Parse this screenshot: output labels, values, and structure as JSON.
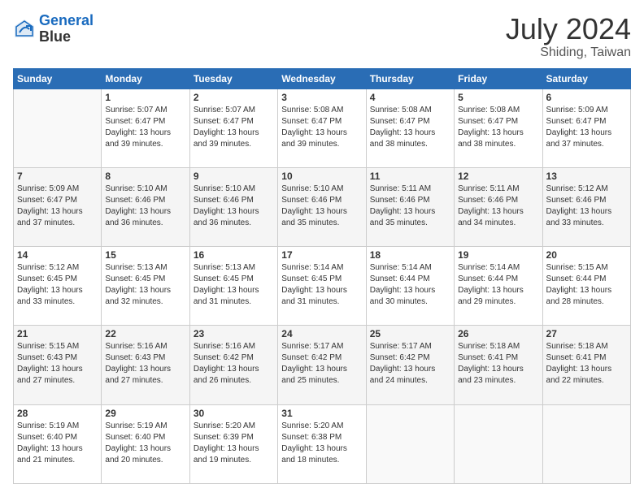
{
  "header": {
    "logo_line1": "General",
    "logo_line2": "Blue",
    "title": "July 2024",
    "subtitle": "Shiding, Taiwan"
  },
  "days_of_week": [
    "Sunday",
    "Monday",
    "Tuesday",
    "Wednesday",
    "Thursday",
    "Friday",
    "Saturday"
  ],
  "weeks": [
    [
      {
        "day": "",
        "info": ""
      },
      {
        "day": "1",
        "info": "Sunrise: 5:07 AM\nSunset: 6:47 PM\nDaylight: 13 hours\nand 39 minutes."
      },
      {
        "day": "2",
        "info": "Sunrise: 5:07 AM\nSunset: 6:47 PM\nDaylight: 13 hours\nand 39 minutes."
      },
      {
        "day": "3",
        "info": "Sunrise: 5:08 AM\nSunset: 6:47 PM\nDaylight: 13 hours\nand 39 minutes."
      },
      {
        "day": "4",
        "info": "Sunrise: 5:08 AM\nSunset: 6:47 PM\nDaylight: 13 hours\nand 38 minutes."
      },
      {
        "day": "5",
        "info": "Sunrise: 5:08 AM\nSunset: 6:47 PM\nDaylight: 13 hours\nand 38 minutes."
      },
      {
        "day": "6",
        "info": "Sunrise: 5:09 AM\nSunset: 6:47 PM\nDaylight: 13 hours\nand 37 minutes."
      }
    ],
    [
      {
        "day": "7",
        "info": "Sunrise: 5:09 AM\nSunset: 6:47 PM\nDaylight: 13 hours\nand 37 minutes."
      },
      {
        "day": "8",
        "info": "Sunrise: 5:10 AM\nSunset: 6:46 PM\nDaylight: 13 hours\nand 36 minutes."
      },
      {
        "day": "9",
        "info": "Sunrise: 5:10 AM\nSunset: 6:46 PM\nDaylight: 13 hours\nand 36 minutes."
      },
      {
        "day": "10",
        "info": "Sunrise: 5:10 AM\nSunset: 6:46 PM\nDaylight: 13 hours\nand 35 minutes."
      },
      {
        "day": "11",
        "info": "Sunrise: 5:11 AM\nSunset: 6:46 PM\nDaylight: 13 hours\nand 35 minutes."
      },
      {
        "day": "12",
        "info": "Sunrise: 5:11 AM\nSunset: 6:46 PM\nDaylight: 13 hours\nand 34 minutes."
      },
      {
        "day": "13",
        "info": "Sunrise: 5:12 AM\nSunset: 6:46 PM\nDaylight: 13 hours\nand 33 minutes."
      }
    ],
    [
      {
        "day": "14",
        "info": "Sunrise: 5:12 AM\nSunset: 6:45 PM\nDaylight: 13 hours\nand 33 minutes."
      },
      {
        "day": "15",
        "info": "Sunrise: 5:13 AM\nSunset: 6:45 PM\nDaylight: 13 hours\nand 32 minutes."
      },
      {
        "day": "16",
        "info": "Sunrise: 5:13 AM\nSunset: 6:45 PM\nDaylight: 13 hours\nand 31 minutes."
      },
      {
        "day": "17",
        "info": "Sunrise: 5:14 AM\nSunset: 6:45 PM\nDaylight: 13 hours\nand 31 minutes."
      },
      {
        "day": "18",
        "info": "Sunrise: 5:14 AM\nSunset: 6:44 PM\nDaylight: 13 hours\nand 30 minutes."
      },
      {
        "day": "19",
        "info": "Sunrise: 5:14 AM\nSunset: 6:44 PM\nDaylight: 13 hours\nand 29 minutes."
      },
      {
        "day": "20",
        "info": "Sunrise: 5:15 AM\nSunset: 6:44 PM\nDaylight: 13 hours\nand 28 minutes."
      }
    ],
    [
      {
        "day": "21",
        "info": "Sunrise: 5:15 AM\nSunset: 6:43 PM\nDaylight: 13 hours\nand 27 minutes."
      },
      {
        "day": "22",
        "info": "Sunrise: 5:16 AM\nSunset: 6:43 PM\nDaylight: 13 hours\nand 27 minutes."
      },
      {
        "day": "23",
        "info": "Sunrise: 5:16 AM\nSunset: 6:42 PM\nDaylight: 13 hours\nand 26 minutes."
      },
      {
        "day": "24",
        "info": "Sunrise: 5:17 AM\nSunset: 6:42 PM\nDaylight: 13 hours\nand 25 minutes."
      },
      {
        "day": "25",
        "info": "Sunrise: 5:17 AM\nSunset: 6:42 PM\nDaylight: 13 hours\nand 24 minutes."
      },
      {
        "day": "26",
        "info": "Sunrise: 5:18 AM\nSunset: 6:41 PM\nDaylight: 13 hours\nand 23 minutes."
      },
      {
        "day": "27",
        "info": "Sunrise: 5:18 AM\nSunset: 6:41 PM\nDaylight: 13 hours\nand 22 minutes."
      }
    ],
    [
      {
        "day": "28",
        "info": "Sunrise: 5:19 AM\nSunset: 6:40 PM\nDaylight: 13 hours\nand 21 minutes."
      },
      {
        "day": "29",
        "info": "Sunrise: 5:19 AM\nSunset: 6:40 PM\nDaylight: 13 hours\nand 20 minutes."
      },
      {
        "day": "30",
        "info": "Sunrise: 5:20 AM\nSunset: 6:39 PM\nDaylight: 13 hours\nand 19 minutes."
      },
      {
        "day": "31",
        "info": "Sunrise: 5:20 AM\nSunset: 6:38 PM\nDaylight: 13 hours\nand 18 minutes."
      },
      {
        "day": "",
        "info": ""
      },
      {
        "day": "",
        "info": ""
      },
      {
        "day": "",
        "info": ""
      }
    ]
  ]
}
